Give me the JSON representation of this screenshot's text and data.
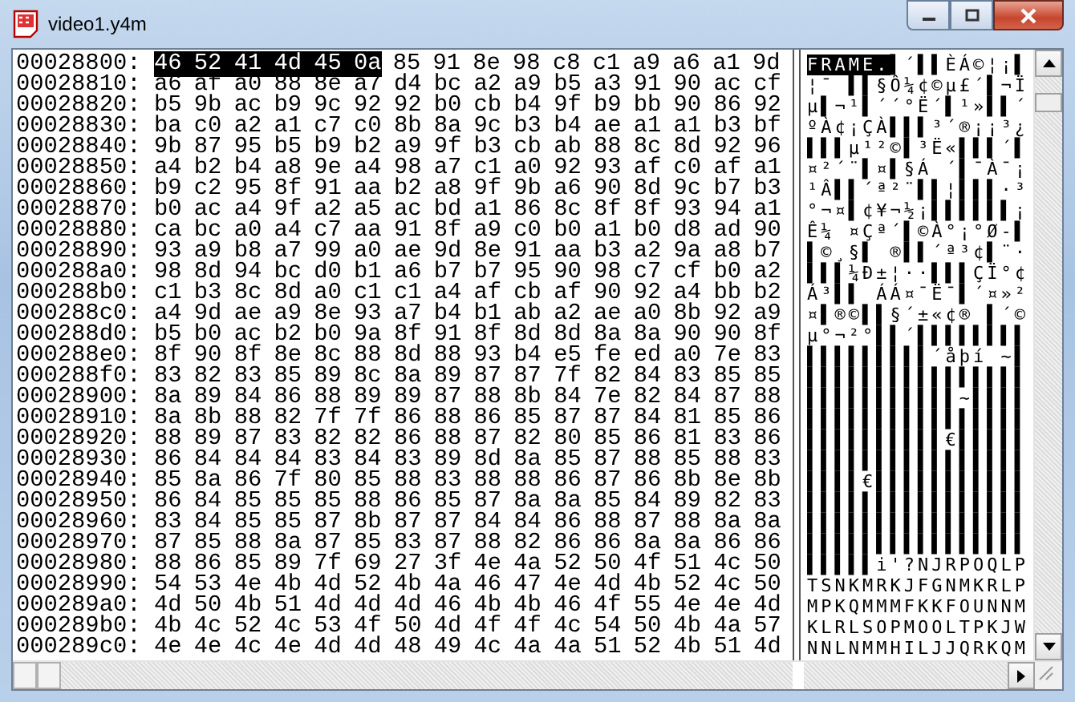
{
  "window": {
    "title": "video1.y4m"
  },
  "rows": [
    {
      "offset": "00028800:",
      "hex": [
        {
          "text": "46 52 41 4d 45 0a",
          "selected": true
        },
        {
          "text": "85 91 8e 98 c8 c1 a9 a6 a1 9d",
          "selected": false
        }
      ],
      "ascii": [
        {
          "text": "FRAME.",
          "selected": true
        },
        {
          "text": "▌´▌▌ÈÁ©¦¡▌",
          "selected": false
        }
      ]
    },
    {
      "offset": "00028810:",
      "hex": [
        {
          "text": "a6 af a0 88 8e a7 d4 bc a2 a9 b5 a3 91 90 ac cf",
          "selected": false
        }
      ],
      "ascii": [
        {
          "text": "¦¯ ▌▌§Ô¼¢©µ£´▌¬Ï",
          "selected": false
        }
      ]
    },
    {
      "offset": "00028820:",
      "hex": [
        {
          "text": "b5 9b ac b9 9c 92 92 b0 cb b4 9f b9 bb 90 86 92",
          "selected": false
        }
      ],
      "ascii": [
        {
          "text": "µ▌¬¹▌´´°Ë´▌¹»▌▌´",
          "selected": false
        }
      ]
    },
    {
      "offset": "00028830:",
      "hex": [
        {
          "text": "ba c0 a2 a1 c7 c0 8b 8a 9c b3 b4 ae a1 a1 b3 bf",
          "selected": false
        }
      ],
      "ascii": [
        {
          "text": "ºÀ¢¡ÇÀ▌▌▌³´®¡¡³¿",
          "selected": false
        }
      ]
    },
    {
      "offset": "00028840:",
      "hex": [
        {
          "text": "9b 87 95 b5 b9 b2 a9 9f b3 cb ab 88 8c 8d 92 96",
          "selected": false
        }
      ],
      "ascii": [
        {
          "text": "▌▌▌µ¹²©▌³Ë«▌▌▌´▌",
          "selected": false
        }
      ]
    },
    {
      "offset": "00028850:",
      "hex": [
        {
          "text": "a4 b2 b4 a8 9e a4 98 a7 c1 a0 92 93 af c0 af a1",
          "selected": false
        }
      ],
      "ascii": [
        {
          "text": "¤²´¨▌¤▌§Á ´▌¯À¯¡",
          "selected": false
        }
      ]
    },
    {
      "offset": "00028860:",
      "hex": [
        {
          "text": "b9 c2 95 8f 91 aa b2 a8 9f 9b a6 90 8d 9c b7 b3",
          "selected": false
        }
      ],
      "ascii": [
        {
          "text": "¹Â▌▌´ª²¨▌▌¦▌▌▌·³",
          "selected": false
        }
      ]
    },
    {
      "offset": "00028870:",
      "hex": [
        {
          "text": "b0 ac a4 9f a2 a5 ac bd a1 86 8c 8f 8f 93 94 a1",
          "selected": false
        }
      ],
      "ascii": [
        {
          "text": "°¬¤▌¢¥¬½¡▌▌▌▌▌▌¡",
          "selected": false
        }
      ]
    },
    {
      "offset": "00028880:",
      "hex": [
        {
          "text": "ca bc a0 a4 c7 aa 91 8f a9 c0 b0 a1 b0 d8 ad 90",
          "selected": false
        }
      ],
      "ascii": [
        {
          "text": "Ê¼ ¤Çª´▌©À°¡°Ø-▌",
          "selected": false
        }
      ]
    },
    {
      "offset": "00028890:",
      "hex": [
        {
          "text": "93 a9 b8 a7 99 a0 ae 9d 8e 91 aa b3 a2 9a a8 b7",
          "selected": false
        }
      ],
      "ascii": [
        {
          "text": "▌©¸§▌ ®▌▌´ª³¢▌¨·",
          "selected": false
        }
      ]
    },
    {
      "offset": "000288a0:",
      "hex": [
        {
          "text": "98 8d 94 bc d0 b1 a6 b7 b7 95 90 98 c7 cf b0 a2",
          "selected": false
        }
      ],
      "ascii": [
        {
          "text": "▌▌▌¼Ð±¦··▌▌▌ÇÏ°¢",
          "selected": false
        }
      ]
    },
    {
      "offset": "000288b0:",
      "hex": [
        {
          "text": "c1 b3 8c 8d a0 c1 c1 a4 af cb af 90 92 a4 bb b2",
          "selected": false
        }
      ],
      "ascii": [
        {
          "text": "Á³▌▌ ÁÁ¤¯Ë¯▌´¤»²",
          "selected": false
        }
      ]
    },
    {
      "offset": "000288c0:",
      "hex": [
        {
          "text": "a4 9d ae a9 8e 93 a7 b4 b1 ab a2 ae a0 8b 92 a9",
          "selected": false
        }
      ],
      "ascii": [
        {
          "text": "¤▌®©▌▌§´±«¢® ▌´©",
          "selected": false
        }
      ]
    },
    {
      "offset": "000288d0:",
      "hex": [
        {
          "text": "b5 b0 ac b2 b0 9a 8f 91 8f 8d 8d 8a 8a 90 90 8f",
          "selected": false
        }
      ],
      "ascii": [
        {
          "text": "µ°¬²°▌▌´▌▌▌▌▌▌▌▌",
          "selected": false
        }
      ]
    },
    {
      "offset": "000288e0:",
      "hex": [
        {
          "text": "8f 90 8f 8e 8c 88 8d 88 93 b4 e5 fe ed a0 7e 83",
          "selected": false
        }
      ],
      "ascii": [
        {
          "text": "▌▌▌▌▌▌▌▌▌´åþí ~▌",
          "selected": false
        }
      ]
    },
    {
      "offset": "000288f0:",
      "hex": [
        {
          "text": "83 82 83 85 89 8c 8a 89 87 87 7f 82 84 83 85 85",
          "selected": false
        }
      ],
      "ascii": [
        {
          "text": "▌▌▌▌▌▌▌▌▌▌▌▌▌▌▌▌",
          "selected": false
        }
      ]
    },
    {
      "offset": "00028900:",
      "hex": [
        {
          "text": "8a 89 84 86 88 89 89 87 88 8b 84 7e 82 84 87 88",
          "selected": false
        }
      ],
      "ascii": [
        {
          "text": "▌▌▌▌▌▌▌▌▌▌▌~▌▌▌▌",
          "selected": false
        }
      ]
    },
    {
      "offset": "00028910:",
      "hex": [
        {
          "text": "8a 8b 88 82 7f 7f 86 88 86 85 87 87 84 81 85 86",
          "selected": false
        }
      ],
      "ascii": [
        {
          "text": "▌▌▌▌▌▌▌▌▌▌▌▌▌▌▌▌",
          "selected": false
        }
      ]
    },
    {
      "offset": "00028920:",
      "hex": [
        {
          "text": "88 89 87 83 82 82 86 88 87 82 80 85 86 81 83 86",
          "selected": false
        }
      ],
      "ascii": [
        {
          "text": "▌▌▌▌▌▌▌▌▌▌€▌▌▌▌▌",
          "selected": false
        }
      ]
    },
    {
      "offset": "00028930:",
      "hex": [
        {
          "text": "86 84 84 84 83 84 83 89 8d 8a 85 87 88 85 88 83",
          "selected": false
        }
      ],
      "ascii": [
        {
          "text": "▌▌▌▌▌▌▌▌▌▌▌▌▌▌▌▌",
          "selected": false
        }
      ]
    },
    {
      "offset": "00028940:",
      "hex": [
        {
          "text": "85 8a 86 7f 80 85 88 83 88 88 86 87 86 8b 8e 8b",
          "selected": false
        }
      ],
      "ascii": [
        {
          "text": "▌▌▌▌€▌▌▌▌▌▌▌▌▌▌▌",
          "selected": false
        }
      ]
    },
    {
      "offset": "00028950:",
      "hex": [
        {
          "text": "86 84 85 85 85 88 86 85 87 8a 8a 85 84 89 82 83",
          "selected": false
        }
      ],
      "ascii": [
        {
          "text": "▌▌▌▌▌▌▌▌▌▌▌▌▌▌▌▌",
          "selected": false
        }
      ]
    },
    {
      "offset": "00028960:",
      "hex": [
        {
          "text": "83 84 85 85 87 8b 87 87 84 84 86 88 87 88 8a 8a",
          "selected": false
        }
      ],
      "ascii": [
        {
          "text": "▌▌▌▌▌▌▌▌▌▌▌▌▌▌▌▌",
          "selected": false
        }
      ]
    },
    {
      "offset": "00028970:",
      "hex": [
        {
          "text": "87 85 88 8a 87 85 83 87 88 82 86 86 8a 8a 86 86",
          "selected": false
        }
      ],
      "ascii": [
        {
          "text": "▌▌▌▌▌▌▌▌▌▌▌▌▌▌▌▌",
          "selected": false
        }
      ]
    },
    {
      "offset": "00028980:",
      "hex": [
        {
          "text": "88 86 85 89 7f 69 27 3f 4e 4a 52 50 4f 51 4c 50",
          "selected": false
        }
      ],
      "ascii": [
        {
          "text": "▌▌▌▌▌i'?NJRPOQLP",
          "selected": false
        }
      ]
    },
    {
      "offset": "00028990:",
      "hex": [
        {
          "text": "54 53 4e 4b 4d 52 4b 4a 46 47 4e 4d 4b 52 4c 50",
          "selected": false
        }
      ],
      "ascii": [
        {
          "text": "TSNKMRKJFGNMKRLP",
          "selected": false
        }
      ]
    },
    {
      "offset": "000289a0:",
      "hex": [
        {
          "text": "4d 50 4b 51 4d 4d 4d 46 4b 4b 46 4f 55 4e 4e 4d",
          "selected": false
        }
      ],
      "ascii": [
        {
          "text": "MPKQMMMFKKFOUNNM",
          "selected": false
        }
      ]
    },
    {
      "offset": "000289b0:",
      "hex": [
        {
          "text": "4b 4c 52 4c 53 4f 50 4d 4f 4f 4c 54 50 4b 4a 57",
          "selected": false
        }
      ],
      "ascii": [
        {
          "text": "KLRLSOPMOOLTPKJW",
          "selected": false
        }
      ]
    },
    {
      "offset": "000289c0:",
      "hex": [
        {
          "text": "4e 4e 4c 4e 4d 4d 48 49 4c 4a 4a 51 52 4b 51 4d",
          "selected": false
        }
      ],
      "ascii": [
        {
          "text": "NNLNMMHILJJQRKQM",
          "selected": false
        }
      ]
    }
  ]
}
